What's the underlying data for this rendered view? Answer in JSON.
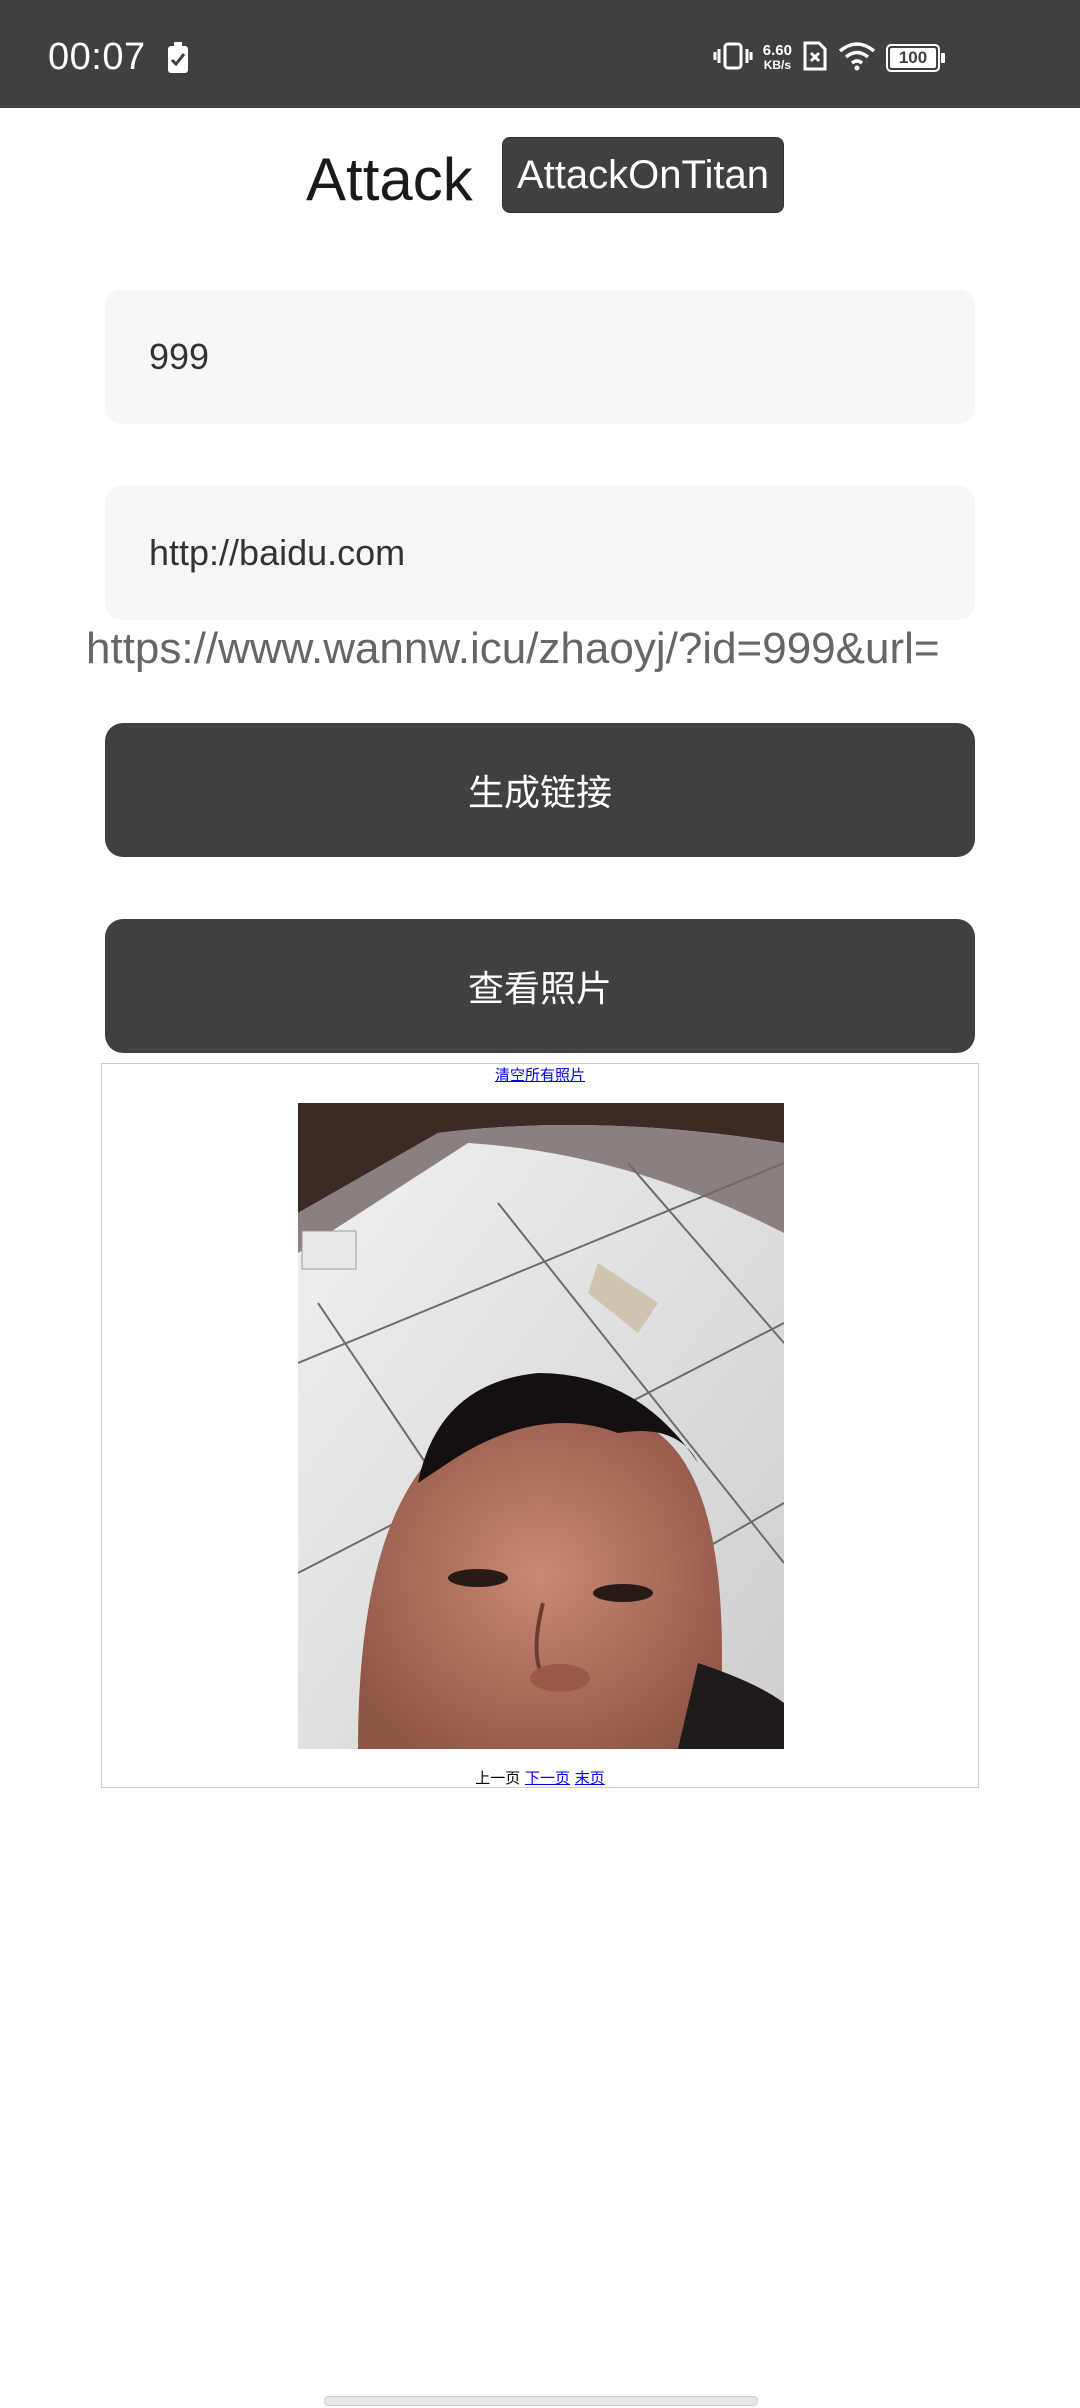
{
  "status_bar": {
    "time": "00:07",
    "net_speed_value": "6.60",
    "net_speed_unit": "KB/s",
    "battery_level": "100",
    "icons": [
      "battery-saver-icon",
      "vibrate-icon",
      "sim-none-icon",
      "wifi-icon",
      "battery-icon"
    ]
  },
  "header": {
    "title": "Attack",
    "chip_label": "AttackOnTitan"
  },
  "form": {
    "id_value": "999",
    "url_value": "http://baidu.com"
  },
  "generated_link": "https://www.wannw.icu/zhaoyj/?id=999&url=",
  "buttons": {
    "generate_label": "生成链接",
    "view_photos_label": "查看照片"
  },
  "webview": {
    "clear_all_label": "清空所有照片",
    "pager": {
      "prev_label": "上一页",
      "next_label": "下一页",
      "last_label": "末页"
    }
  },
  "colors": {
    "status_bar_bg": "#404040",
    "button_bg": "#404040",
    "field_bg": "#f7f7f7",
    "link_text": "#666666",
    "hyperlink": "#0000ee"
  }
}
